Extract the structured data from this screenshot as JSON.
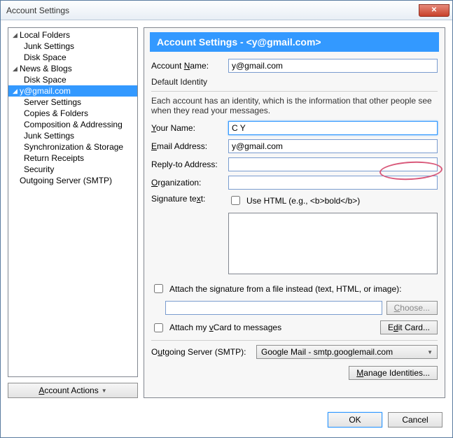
{
  "window": {
    "title": "Account Settings"
  },
  "tree": {
    "localFolders": {
      "label": "Local Folders",
      "children": {
        "junk": "Junk Settings",
        "disk": "Disk Space"
      }
    },
    "newsBlogs": {
      "label": "News & Blogs",
      "children": {
        "disk": "Disk Space"
      }
    },
    "account": {
      "label": "y@gmail.com",
      "children": {
        "server": "Server Settings",
        "copies": "Copies & Folders",
        "composition": "Composition & Addressing",
        "junk": "Junk Settings",
        "sync": "Synchronization & Storage",
        "returnReceipts": "Return Receipts",
        "security": "Security"
      }
    },
    "outgoing": "Outgoing Server (SMTP)"
  },
  "accountActions": {
    "label": "Account Actions"
  },
  "panel": {
    "headerPrefix": "Account Settings - ",
    "headerAccount": "<y@gmail.com>",
    "accountNameLabel": "Account Name:",
    "accountNameValue": "y@gmail.com",
    "identityTitle": "Default Identity",
    "identityDesc": "Each account has an identity, which is the information that other people see when they read your messages.",
    "yourNameLabel": "Your Name:",
    "yourNameValue": "C Y",
    "emailLabel": "Email Address:",
    "emailValue": "y@gmail.com",
    "replyToLabel": "Reply-to Address:",
    "replyToValue": "",
    "orgLabel": "Organization:",
    "orgValue": "",
    "sigTextLabel": "Signature text:",
    "useHtmlLabel": "Use HTML (e.g., <b>bold</b>)",
    "sigValue": "",
    "attachSigLabel": "Attach the signature from a file instead (text, HTML, or image):",
    "chooseLabel": "Choose...",
    "attachVcardLabel": "Attach my vCard to messages",
    "editCardLabel": "Edit Card...",
    "smtpLabel": "Outgoing Server (SMTP):",
    "smtpValue": "Google Mail - smtp.googlemail.com",
    "manageIdentitiesLabel": "Manage Identities..."
  },
  "footer": {
    "ok": "OK",
    "cancel": "Cancel"
  }
}
